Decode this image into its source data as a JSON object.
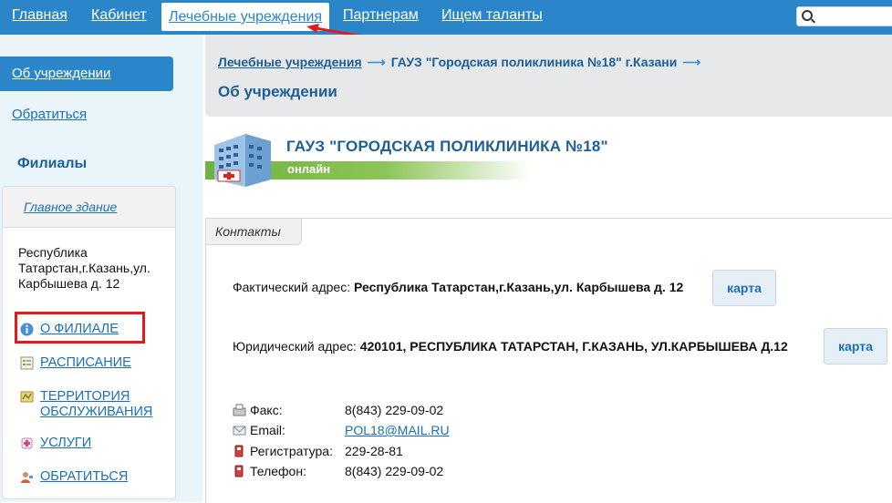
{
  "nav": {
    "items": [
      "Главная",
      "Кабинет",
      "Лечебные учреждения",
      "Партнерам",
      "Ищем таланты"
    ],
    "active": "Лечебные учреждения",
    "search_placeholder": ""
  },
  "sidebar": {
    "active_item": "Об учреждении",
    "link_contact": "Обратиться",
    "section_title": "Филиалы",
    "branch": {
      "name": "Главное здание",
      "address": "Республика Татарстан,г.Казань,ул. Карбышева д. 12",
      "items": [
        {
          "icon": "info-icon",
          "label": "О ФИЛИАЛЕ"
        },
        {
          "icon": "schedule-icon",
          "label": "РАСПИСАНИЕ"
        },
        {
          "icon": "territory-icon",
          "label_line1": "ТЕРРИТОРИЯ",
          "label_line2": "ОБСЛУЖИВАНИЯ"
        },
        {
          "icon": "services-icon",
          "label": "УСЛУГИ"
        },
        {
          "icon": "contact-person-icon",
          "label": "ОБРАТИТЬСЯ"
        }
      ]
    }
  },
  "breadcrumb": {
    "items": [
      "Лечебные учреждения",
      "ГАУЗ \"Городская поликлиника №18\" г.Казани"
    ],
    "title": "Об учреждении"
  },
  "banner": {
    "title": "ГАУЗ \"ГОРОДСКАЯ ПОЛИКЛИНИКА №18\"",
    "status": "онлайн"
  },
  "contacts": {
    "tab": "Контакты",
    "actual_label": "Фактический адрес:",
    "actual_value": "Республика Татарстан,г.Казань,ул. Карбышева д. 12",
    "legal_label": "Юридический адрес:",
    "legal_value": "420101, РЕСПУБЛИКА ТАТАРСТАН, Г.КАЗАНЬ, УЛ.КАРБЫШЕВА Д.12",
    "map_button": "карта",
    "rows": [
      {
        "icon": "fax-icon",
        "label": "Факс:",
        "value": "8(843) 229-09-02"
      },
      {
        "icon": "email-icon",
        "label": "Email:",
        "value": "POL18@MAIL.RU"
      },
      {
        "icon": "phone-icon",
        "label": "Регистратура:",
        "value": "229-28-81"
      },
      {
        "icon": "phone-icon",
        "label": "Телефон:",
        "value": "8(843) 229-09-02"
      }
    ]
  },
  "colors": {
    "nav_bg": "#2a86c9",
    "heading": "#1d5f96",
    "annotation_red": "#e01b1b",
    "status_green": "#6fb240"
  }
}
